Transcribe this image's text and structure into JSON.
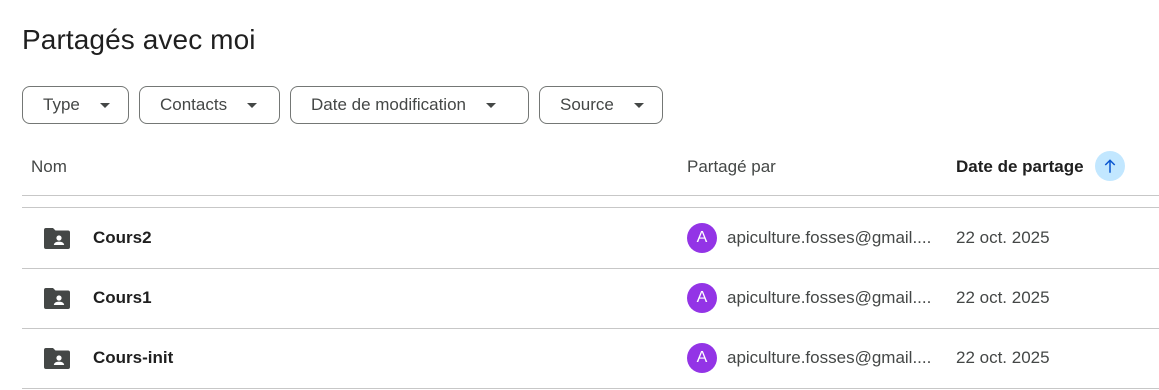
{
  "page": {
    "title": "Partagés avec moi"
  },
  "filters": [
    {
      "label": "Type"
    },
    {
      "label": "Contacts"
    },
    {
      "label": "Date de modification"
    },
    {
      "label": "Source"
    }
  ],
  "table": {
    "columns": {
      "name": "Nom",
      "shared_by": "Partagé par",
      "share_date": "Date de partage"
    },
    "sort": {
      "column": "share_date",
      "direction": "ascending",
      "icon": "arrow-up-icon"
    },
    "rows": [
      {
        "icon": "shared-folder-icon",
        "name": "Cours2",
        "owner_initial": "A",
        "owner": "apiculture.fosses@gmail....",
        "date": "22 oct. 2025"
      },
      {
        "icon": "shared-folder-icon",
        "name": "Cours1",
        "owner_initial": "A",
        "owner": "apiculture.fosses@gmail....",
        "date": "22 oct. 2025"
      },
      {
        "icon": "shared-folder-icon",
        "name": "Cours-init",
        "owner_initial": "A",
        "owner": "apiculture.fosses@gmail....",
        "date": "22 oct. 2025"
      }
    ]
  },
  "colors": {
    "avatar": "#9334e6",
    "sort_button_bg": "#c2e7ff",
    "sort_arrow": "#0b57d0"
  }
}
